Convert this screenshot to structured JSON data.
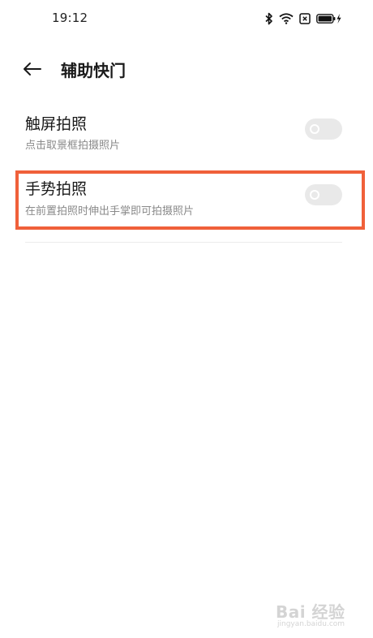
{
  "status_bar": {
    "time": "19:12",
    "icons": [
      "bluetooth-icon",
      "wifi-icon",
      "sim-off-icon",
      "battery-charging-icon"
    ]
  },
  "header": {
    "back_icon": "arrow-left-icon",
    "title": "辅助快门"
  },
  "settings": [
    {
      "title": "触屏拍照",
      "description": "点击取景框拍摄照片",
      "enabled": false
    },
    {
      "title": "手势拍照",
      "description": "在前置拍照时伸出手掌即可拍摄照片",
      "enabled": false,
      "highlighted": true
    }
  ],
  "watermark": {
    "main": "Bai 经验",
    "sub": "jingyan.baidu.com"
  },
  "colors": {
    "highlight": "#f0603a",
    "toggle_off": "#e9e9e9",
    "secondary_text": "#8a8a8a"
  }
}
